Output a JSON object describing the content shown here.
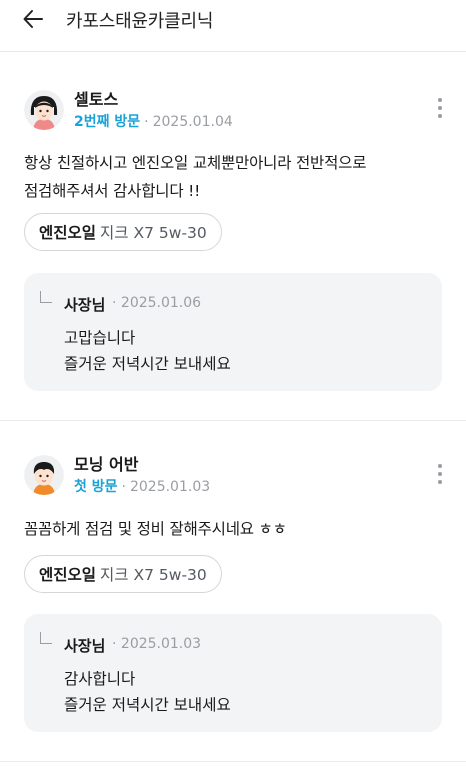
{
  "header": {
    "title": "카포스태윤카클리닉",
    "back_icon": "arrow-left-icon"
  },
  "reviews": [
    {
      "author": "셀토스",
      "visit": "2번째 방문",
      "date": "2025.01.04",
      "text_line1": "항상 친절하시고 엔진오일 교체뿐만아니라 전반적으로",
      "text_line2": "점검해주셔서 감사합니다 !!",
      "chip": {
        "name": "엔진오일",
        "detail": "지크 X7 5w-30"
      },
      "reply": {
        "owner": "사장님",
        "date": "2025.01.06",
        "line1": "고맙습니다",
        "line2": "즐거운 저녁시간 보내세요"
      }
    },
    {
      "author": "모닝 어반",
      "visit": "첫 방문",
      "date": "2025.01.03",
      "text_line1": "꼼꼼하게 점검 및 정비 잘해주시네요 ㅎㅎ",
      "chip": {
        "name": "엔진오일",
        "detail": "지크 X7 5w-30"
      },
      "reply": {
        "owner": "사장님",
        "date": "2025.01.03",
        "line1": "감사합니다",
        "line2": "즐거운 저녁시간 보내세요"
      }
    }
  ],
  "colors": {
    "visit_accent": "#1aa3d8",
    "muted": "#9a9da3",
    "reply_bg": "#f3f4f6"
  }
}
